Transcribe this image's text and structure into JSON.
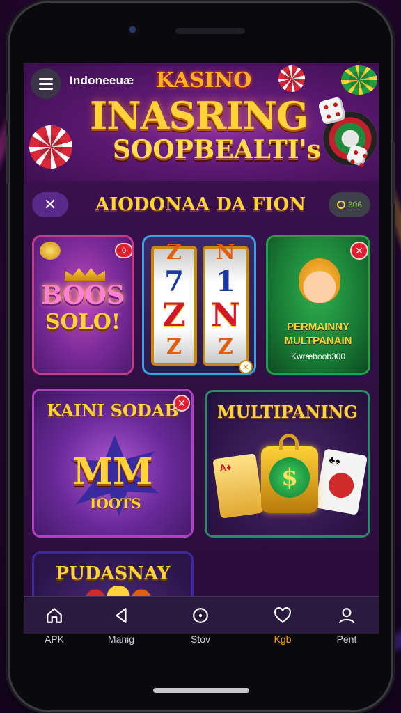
{
  "header": {
    "brand": "Indoneeuæ",
    "kasino": "KASINO",
    "title_line1": "INASRING",
    "title_line2": "SOOPBEALTI's"
  },
  "section": {
    "title": "AIODONAA DA FION",
    "coin_count": "306"
  },
  "cards": [
    {
      "line1": "BOOS",
      "line2": "SOLO!",
      "badge": "0",
      "icon": "crown-icon"
    },
    {
      "reels": [
        [
          "Z",
          "7",
          "Z",
          "Z"
        ],
        [
          "N",
          "1",
          "N",
          "Z"
        ]
      ],
      "icon": "slot-reels-icon"
    },
    {
      "line1": "PERMAINNY",
      "line2": "MULTPANAIN",
      "line3": "Kwræboob300",
      "icon": "character-icon"
    },
    {
      "line1": "KAINI SODAB",
      "line2": "MM",
      "line3": "IOOTS",
      "icon": "burst-icon"
    },
    {
      "line1": "MULTIPANING",
      "icon": "dollar-lock-icon"
    },
    {
      "line1": "PUDASNAY",
      "icon": "coins-icon"
    }
  ],
  "nav": {
    "items": [
      {
        "label": "APK",
        "icon": "home-icon"
      },
      {
        "label": "Manig",
        "icon": "back-icon"
      },
      {
        "label": "Stov",
        "icon": "circle-icon"
      },
      {
        "label": "Kgb",
        "icon": "heart-icon"
      },
      {
        "label": "Pent",
        "icon": "person-icon"
      }
    ],
    "active_index": 3
  },
  "colors": {
    "accent_gold": "#ffd23a",
    "bg_purple": "#341046",
    "active_nav": "#f0a030"
  }
}
